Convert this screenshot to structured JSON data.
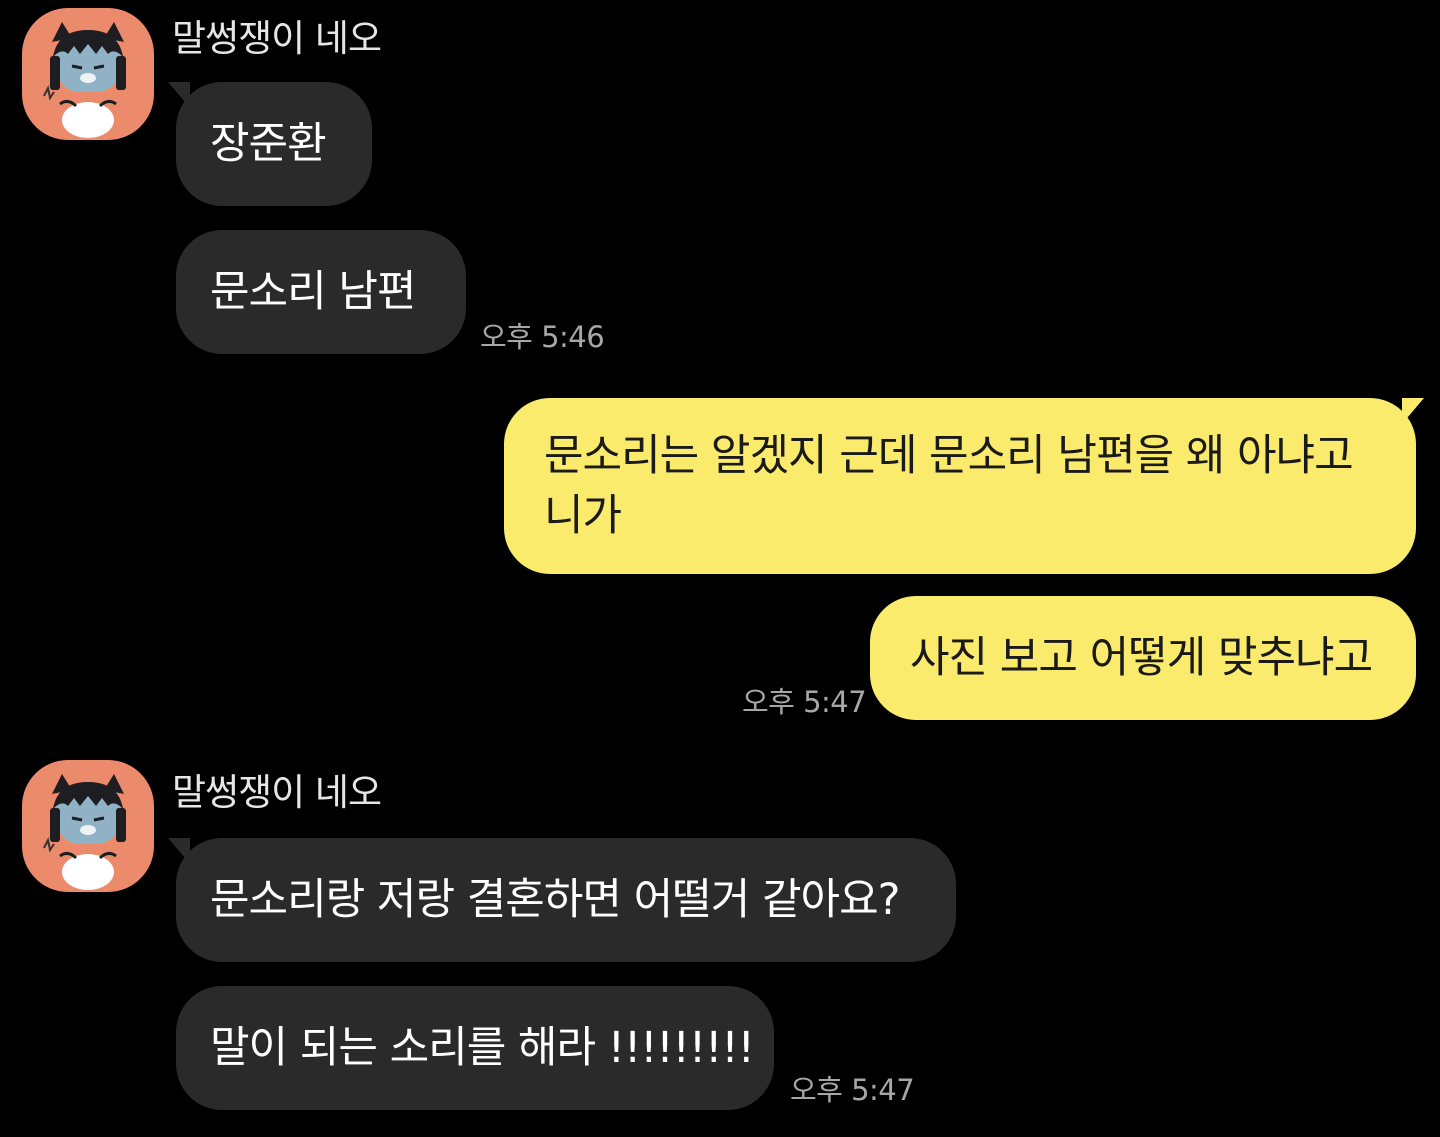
{
  "colors": {
    "background": "#000000",
    "incoming_bubble": "#2a2a2a",
    "outgoing_bubble": "#fbeb6d",
    "avatar_bg": "#ec8a6c",
    "timestamp": "#a7a7a7"
  },
  "groups": [
    {
      "sender": "말썽쟁이 네오",
      "avatar_icon": "neo-character-icon",
      "messages": [
        "장준환",
        "문소리 남편"
      ],
      "time": "오후 5:46"
    },
    {
      "sender": "me",
      "messages": [
        "문소리는 알겠지 근데 문소리 남편을 왜 아냐고 니가",
        "사진 보고 어떻게 맞추냐고"
      ],
      "time": "오후 5:47"
    },
    {
      "sender": "말썽쟁이 네오",
      "avatar_icon": "neo-character-icon",
      "messages": [
        "문소리랑 저랑 결혼하면 어떨거 같아요?",
        "말이 되는 소리를 해라 !!!!!!!!!"
      ],
      "time": "오후 5:47"
    }
  ]
}
